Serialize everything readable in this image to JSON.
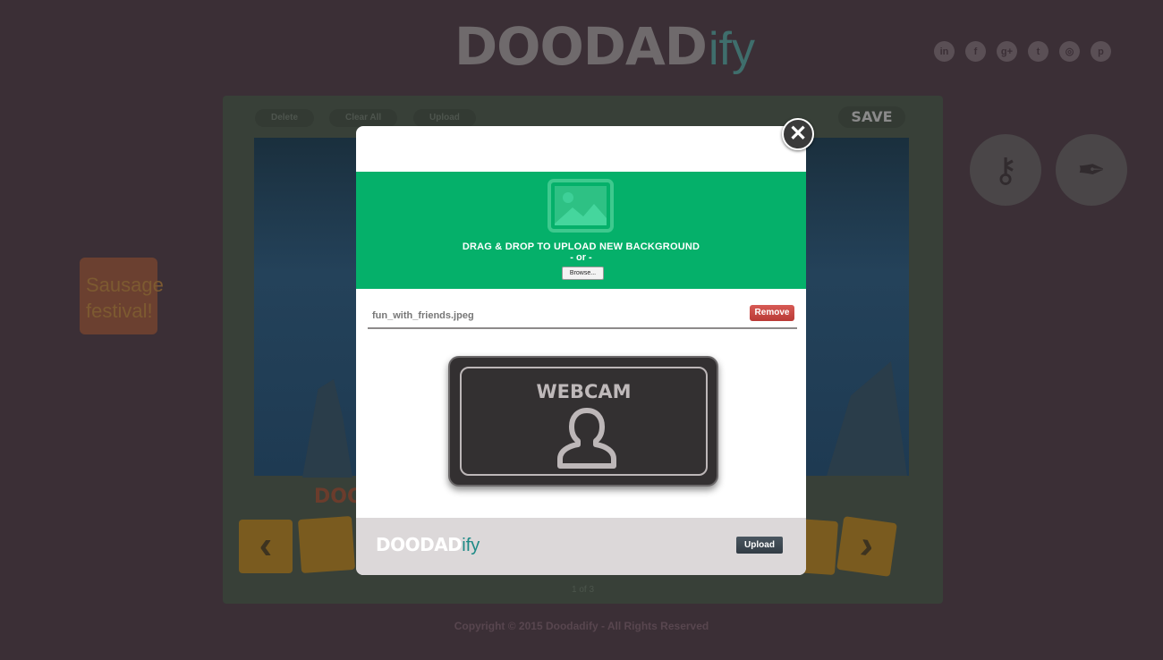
{
  "header": {
    "logo_main": "DOODAD",
    "logo_sub": "ify",
    "social_icons": [
      "linkedin-icon",
      "facebook-icon",
      "google-plus-icon",
      "twitter-icon",
      "instagram-icon",
      "pinterest-icon"
    ],
    "social_glyphs": [
      "in",
      "f",
      "g+",
      "t",
      "◎",
      "p"
    ]
  },
  "editor": {
    "toolbar": {
      "delete_label": "Delete",
      "clear_all_label": "Clear All",
      "upload_label": "Upload",
      "save_label": "SAVE"
    },
    "section_label": "DOO",
    "pager_text": "1 of 3"
  },
  "sticky_note": {
    "text": "Sausage festival!"
  },
  "modal": {
    "drop_text": "DRAG & DROP TO UPLOAD NEW BACKGROUND",
    "or_text": "- or -",
    "browse_label": "Browse...",
    "file_name": "fun_with_friends.jpeg",
    "remove_label": "Remove",
    "webcam_label": "WEBCAM",
    "footer_logo_main": "DOODAD",
    "footer_logo_sub": "ify",
    "upload_label": "Upload",
    "colors": {
      "drop_zone": "#05b06a",
      "remove": "#c9463f",
      "upload": "#3d4852"
    }
  },
  "footer": {
    "copyright": "Copyright © 2015 Doodadify - All Rights Reserved"
  }
}
